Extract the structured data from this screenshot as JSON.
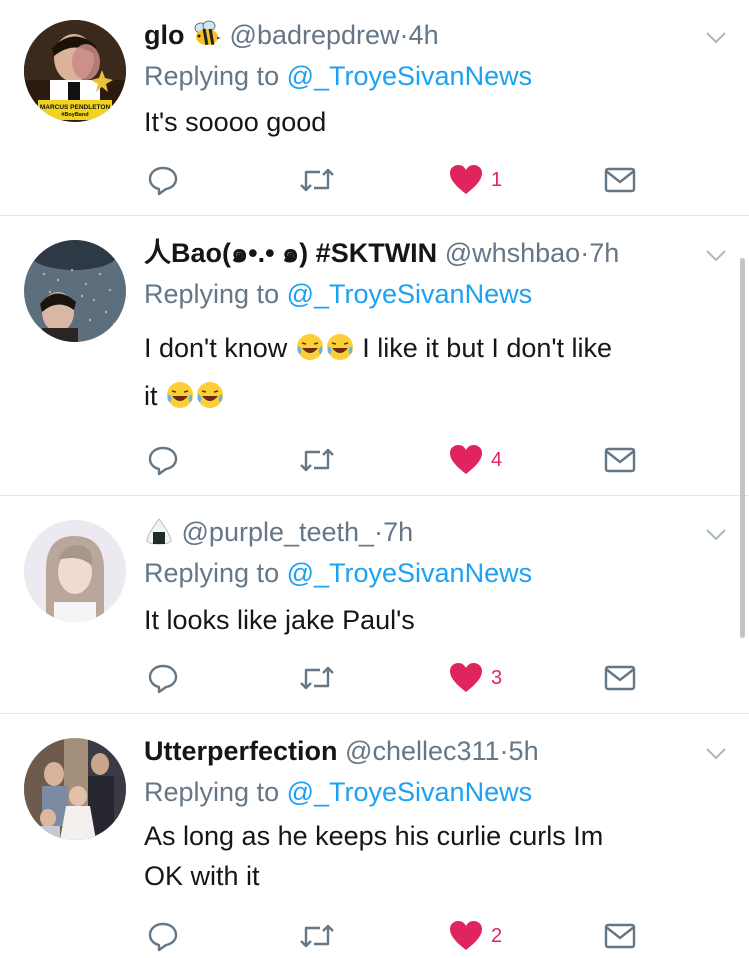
{
  "tweets": [
    {
      "name": "glo",
      "name_emoji": "bee",
      "handle": "@badrepdrew",
      "dot": "·",
      "time": "4h",
      "replying_prefix": "Replying to ",
      "replying_to": "@_TroyeSivanNews",
      "text": "It's soooo good",
      "likes": "1",
      "avatar_caption_1": "MARCUS PENDLETON",
      "avatar_caption_2": "#BoyBand"
    },
    {
      "name": "人Bao(๑•.• ๑) #SKTWIN",
      "handle": "@whshbao",
      "dot": "·",
      "time": "7h",
      "replying_prefix": "Replying to ",
      "replying_to": "@_TroyeSivanNews",
      "text_part_1": "I don't know",
      "text_part_2": "I like it but I don't like",
      "text_part_3": "it",
      "likes": "4"
    },
    {
      "name_emoji": "rice-ball",
      "handle": "@purple_teeth_",
      "dot": "·",
      "time": "7h",
      "replying_prefix": "Replying to ",
      "replying_to": "@_TroyeSivanNews",
      "text": "It looks like jake Paul's",
      "likes": "3"
    },
    {
      "name": "Utterperfection",
      "handle": "@chellec311",
      "dot": "·",
      "time": "5h",
      "replying_prefix": "Replying to ",
      "replying_to": "@_TroyeSivanNews",
      "text_line_1": "As long as he keeps his curlie curls Im",
      "text_line_2": "OK with it",
      "likes": "2"
    }
  ],
  "colors": {
    "link": "#1da1f2",
    "secondary": "#657786",
    "like": "#e0245e",
    "icon": "#657786",
    "divider": "#e1e8ed"
  }
}
